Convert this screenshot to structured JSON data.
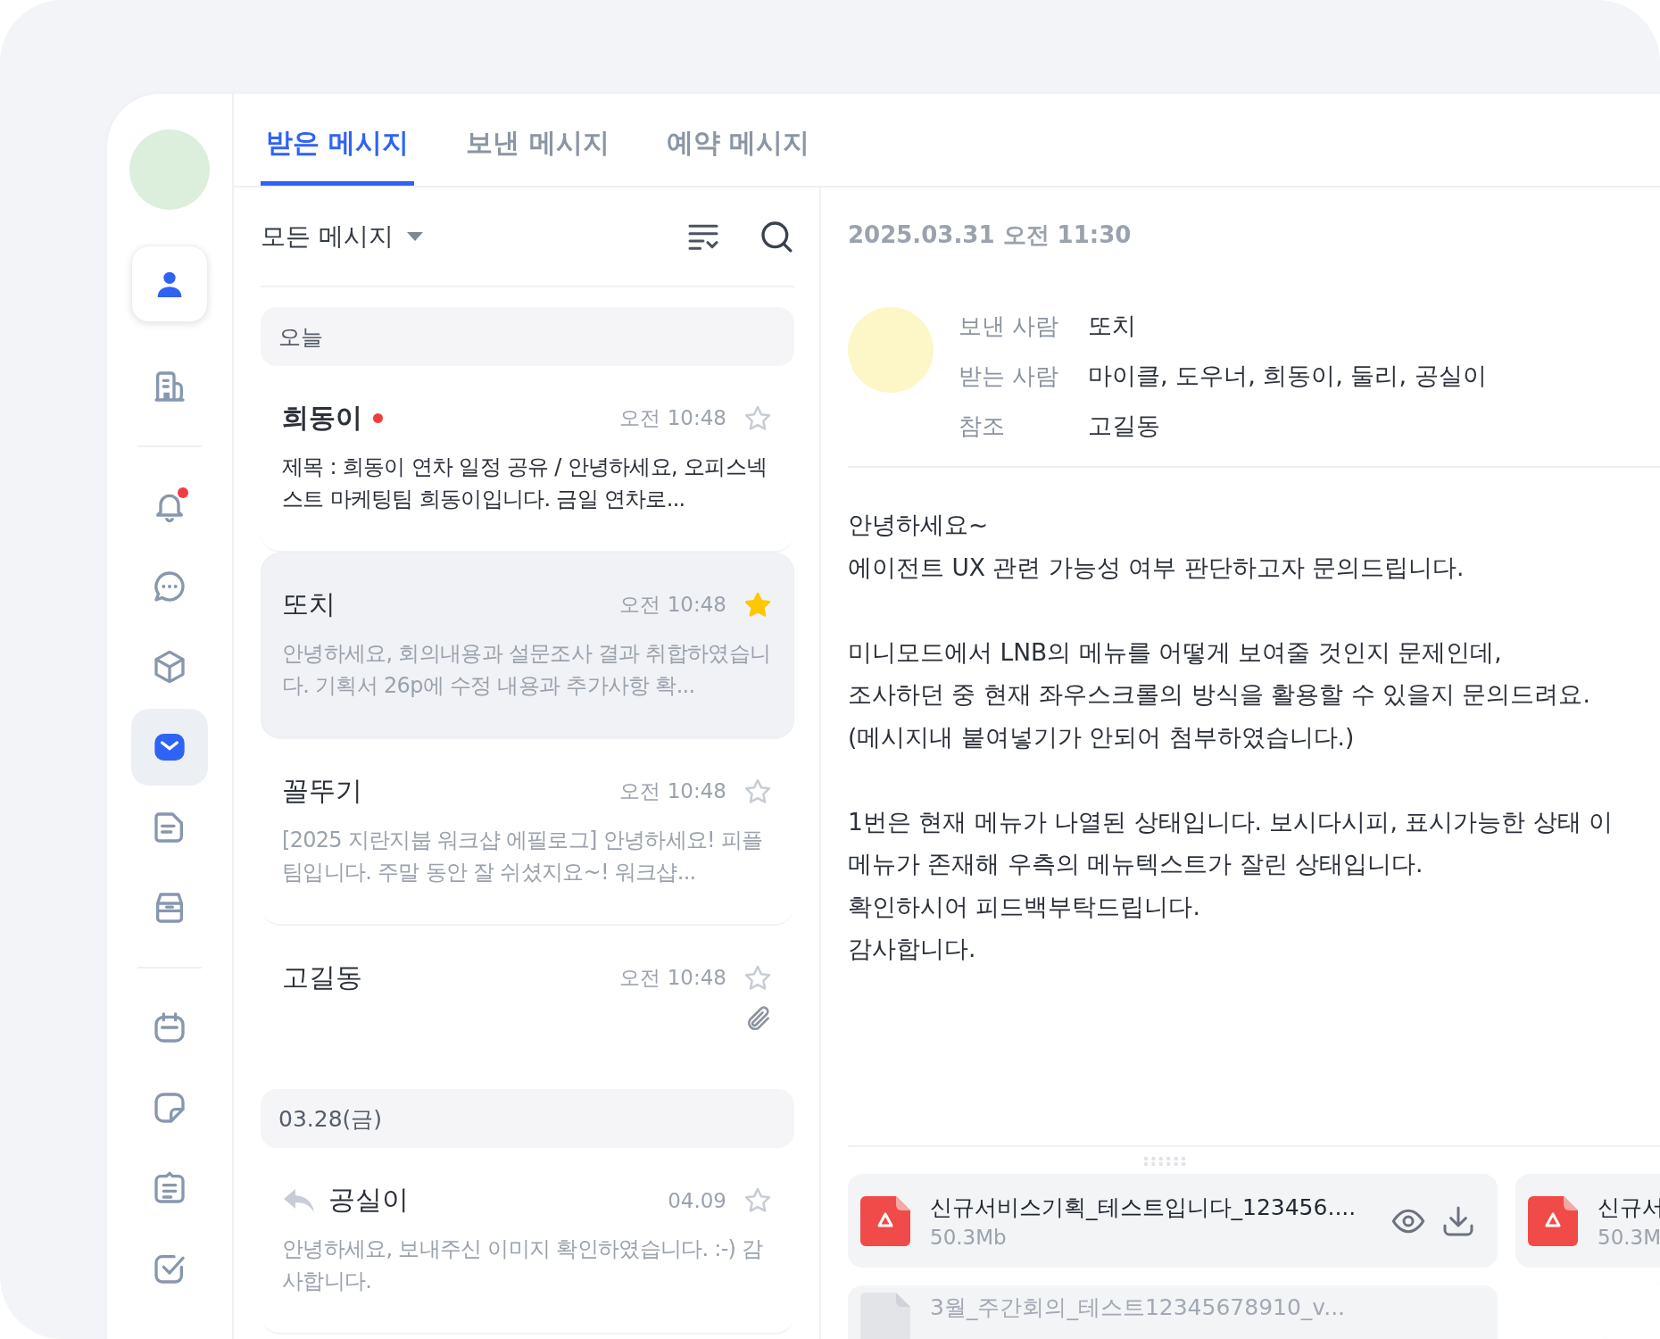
{
  "sidebar": {
    "groups": [
      [
        {
          "kind": "person",
          "elevated": true,
          "selected": false,
          "badge": false
        },
        {
          "kind": "building",
          "elevated": false,
          "selected": false,
          "badge": false
        }
      ],
      [
        {
          "kind": "bell",
          "elevated": false,
          "selected": false,
          "badge": true
        },
        {
          "kind": "chat",
          "elevated": false,
          "selected": false,
          "badge": false
        },
        {
          "kind": "cube",
          "elevated": false,
          "selected": false,
          "badge": false
        },
        {
          "kind": "mail",
          "elevated": false,
          "selected": true,
          "badge": false
        },
        {
          "kind": "note",
          "elevated": false,
          "selected": false,
          "badge": false
        },
        {
          "kind": "archive",
          "elevated": false,
          "selected": false,
          "badge": false
        }
      ],
      [
        {
          "kind": "calendar",
          "elevated": false,
          "selected": false,
          "badge": false
        },
        {
          "kind": "sticky",
          "elevated": false,
          "selected": false,
          "badge": false
        },
        {
          "kind": "list",
          "elevated": false,
          "selected": false,
          "badge": false
        },
        {
          "kind": "check",
          "elevated": false,
          "selected": false,
          "badge": false
        }
      ]
    ]
  },
  "tabs": [
    {
      "label": "받은 메시지",
      "selected": true
    },
    {
      "label": "보낸 메시지",
      "selected": false
    },
    {
      "label": "예약 메시지",
      "selected": false
    }
  ],
  "list": {
    "filter": "모든 메시지",
    "groups": [
      {
        "label": "오늘",
        "messages": [
          {
            "sender": "희동이",
            "unread": true,
            "time": "오전 10:48",
            "starred": false,
            "selected": false,
            "replied": false,
            "attachment": false,
            "preview": "제목 : 희동이 연차 일정 공유 / 안녕하세요, 오피스넥스트 마케팅팀 희동이입니다. 금일 연차로..."
          },
          {
            "sender": "또치",
            "unread": false,
            "time": "오전 10:48",
            "starred": true,
            "selected": true,
            "replied": false,
            "attachment": false,
            "preview": "안녕하세요, 회의내용과 설문조사 결과 취합하였습니다. 기획서 26p에 수정 내용과 추가사항 확..."
          },
          {
            "sender": "꼴뚜기",
            "unread": false,
            "time": "오전 10:48",
            "starred": false,
            "selected": false,
            "replied": false,
            "attachment": false,
            "preview": "[2025 지란지붑 워크샵 에필로그] 안녕하세요! 피플팀입니다. 주말 동안 잘 쉬셨지요~! 워크샵..."
          },
          {
            "sender": "고길동",
            "unread": false,
            "time": "오전 10:48",
            "starred": false,
            "selected": false,
            "replied": false,
            "attachment": true
          }
        ]
      },
      {
        "label": "03.28(금)",
        "messages": [
          {
            "sender": "공실이",
            "unread": false,
            "time": "04.09",
            "starred": false,
            "selected": false,
            "replied": true,
            "attachment": false,
            "preview": "안녕하세요, 보내주신 이미지 확인하였습니다. :-) 감사합니다."
          }
        ]
      }
    ]
  },
  "detail": {
    "date": "2025.03.31 오전 11:30",
    "fields": [
      {
        "label": "보낸 사람",
        "value": "또치"
      },
      {
        "label": "받는 사람",
        "value": "마이클, 도우너, 희동이, 둘리, 공실이"
      },
      {
        "label": "참조",
        "value": "고길동"
      }
    ],
    "paragraphs": [
      [
        "안녕하세요~",
        "에이전트 UX 관련 가능성 여부 판단하고자 문의드립니다."
      ],
      [
        "미니모드에서 LNB의 메뉴를 어떻게 보여줄 것인지 문제인데,",
        "조사하던 중 현재 좌우스크롤의 방식을 활용할 수 있을지 문의드려요.",
        "(메시지내 붙여넣기가 안되어 첨부하였습니다.)"
      ],
      [
        "1번은 현재 메뉴가 나열된 상태입니다. 보시다시피, 표시가능한 상태 이",
        "메뉴가 존재해 우측의 메뉴텍스트가 잘린 상태입니다.",
        "확인하시어 피드백부탁드립니다.",
        "감사합니다."
      ]
    ],
    "attachments": [
      {
        "kind": "pdf",
        "name": "신규서비스기획_테스트입니다_123456....",
        "size": "50.3Mb"
      },
      {
        "kind": "pdf",
        "name": "신규서",
        "size": "50.3M"
      },
      {
        "kind": "file",
        "name": "3월_주간회의_테스트12345678910_v..."
      }
    ]
  }
}
